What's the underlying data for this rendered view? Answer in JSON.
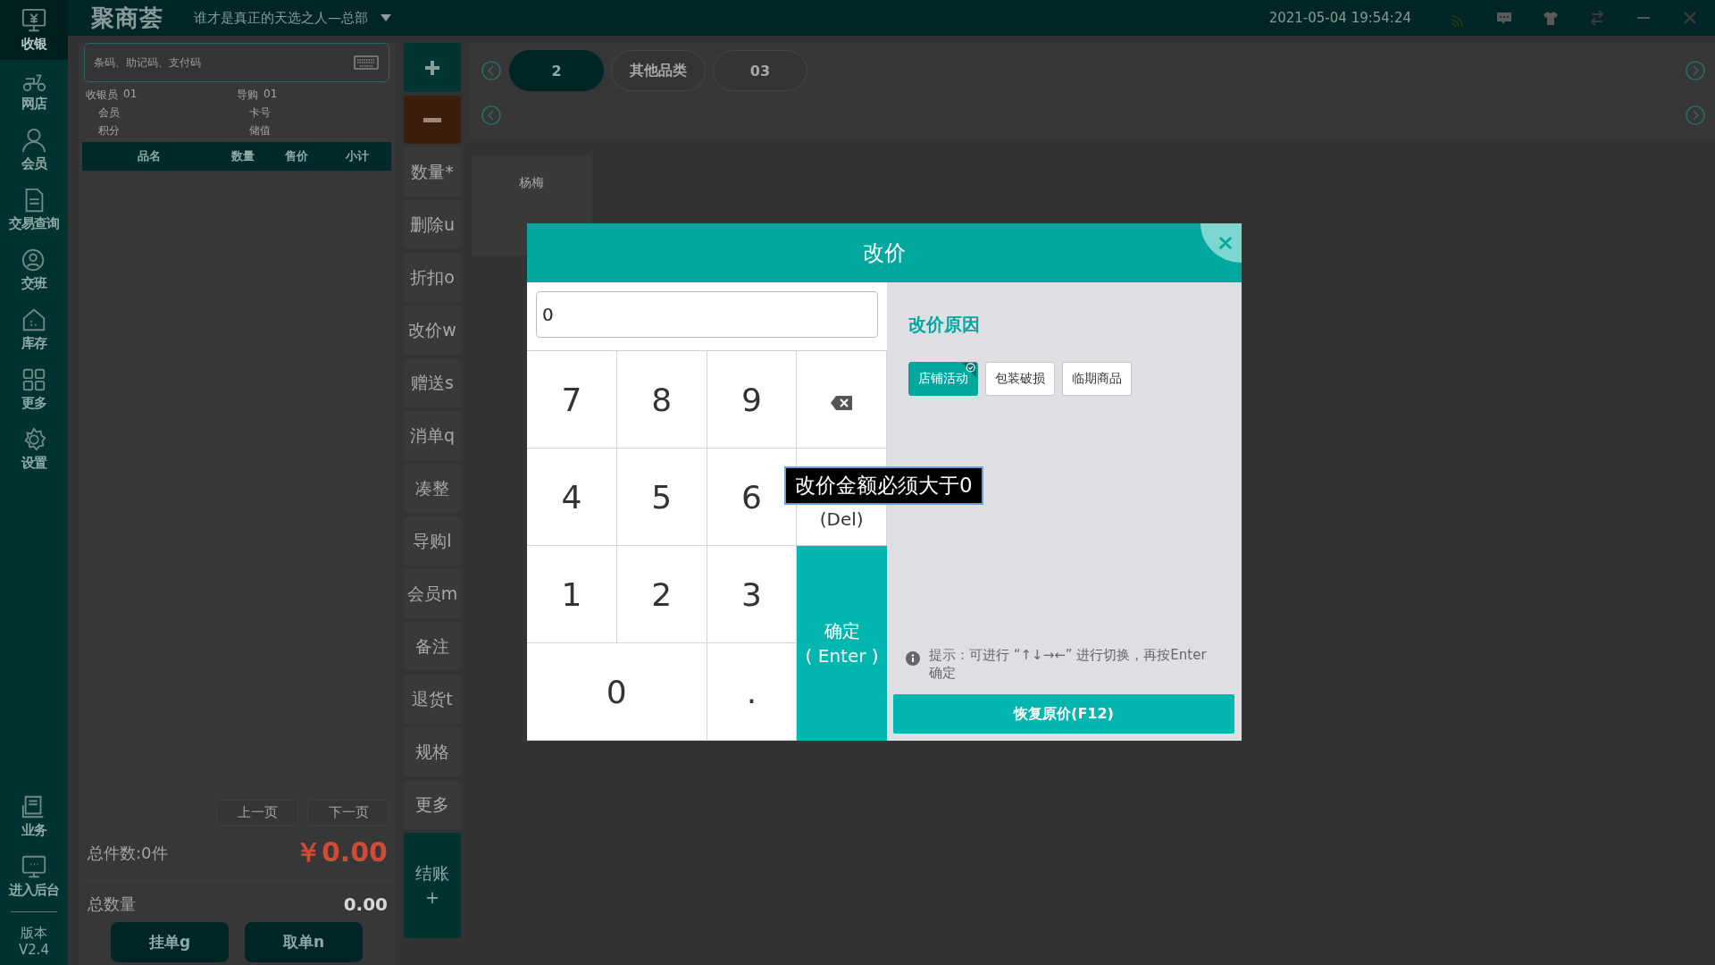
{
  "top_bar": {
    "brand": "聚商荟",
    "store": "谁才是真正的天选之人—总部",
    "datetime": "2021-05-04 19:54:24"
  },
  "sidebar": {
    "items": [
      {
        "label": "收银",
        "selected": true
      },
      {
        "label": "网店",
        "selected": false
      },
      {
        "label": "会员",
        "selected": false
      },
      {
        "label": "交易查询",
        "selected": false
      },
      {
        "label": "交班",
        "selected": false
      },
      {
        "label": "库存",
        "selected": false
      },
      {
        "label": "更多",
        "selected": false
      },
      {
        "label": "设置",
        "selected": false
      }
    ],
    "bottom_items": [
      {
        "label": "业务"
      },
      {
        "label": "进入后台"
      }
    ],
    "version_label": "版本",
    "version": "V2.4"
  },
  "order_panel": {
    "search": {
      "placeholder": "条码、助记码、支付码"
    },
    "info": [
      {
        "label": "收银员",
        "value": "01"
      },
      {
        "label": "导购",
        "value": "01"
      },
      {
        "label": "会员"
      },
      {
        "label": "卡号"
      },
      {
        "label": "积分"
      },
      {
        "label": "储值"
      }
    ],
    "table": {
      "columns": [
        "品名",
        "数量",
        "售价",
        "小计"
      ]
    },
    "pagination": [
      "上一页",
      "下一页"
    ],
    "total_items": "总件数:0件",
    "total_amount": "￥0.00",
    "total_qty_label": "总数量",
    "total_qty": "0.00",
    "buttons": [
      "挂单g",
      "取单n"
    ]
  },
  "actions": {
    "buttons": [
      "数量*",
      "删除u",
      "折扣o",
      "改价w",
      "赠送s",
      "消单q",
      "凑整",
      "导购l",
      "会员m",
      "备注",
      "退货t",
      "规格",
      "更多"
    ],
    "checkout": "结账",
    "checkout_key": "+"
  },
  "categories": [
    {
      "label": "2",
      "selected": true
    },
    {
      "label": "其他品类",
      "selected": false
    },
    {
      "label": "03",
      "selected": false
    }
  ],
  "products": [
    {
      "name": "杨梅"
    }
  ],
  "dialog": {
    "title": "改价",
    "value": "0",
    "keys": [
      {
        "kind": "digit",
        "label": "7"
      },
      {
        "kind": "digit",
        "label": "8"
      },
      {
        "kind": "digit",
        "label": "9"
      },
      {
        "kind": "backspace"
      },
      {
        "kind": "digit",
        "label": "4"
      },
      {
        "kind": "digit",
        "label": "5"
      },
      {
        "kind": "digit",
        "label": "6"
      },
      {
        "kind": "clear",
        "label": "(Del)"
      },
      {
        "kind": "digit",
        "label": "1"
      },
      {
        "kind": "digit",
        "label": "2"
      },
      {
        "kind": "digit",
        "label": "3"
      },
      {
        "kind": "confirm",
        "label": "确定",
        "sub": "( Enter )"
      },
      {
        "kind": "zero",
        "label": "0"
      },
      {
        "kind": "digit",
        "label": "."
      }
    ],
    "reason_title": "改价原因",
    "reasons": [
      {
        "label": "店铺活动",
        "selected": true
      },
      {
        "label": "包装破损",
        "selected": false
      },
      {
        "label": "临期商品",
        "selected": false
      }
    ],
    "hint": "提示：可进行 “↑↓→←” 进行切换，再按Enter确定",
    "restore": "恢复原价(F12)",
    "tooltip": "改价金额必须大于0"
  }
}
